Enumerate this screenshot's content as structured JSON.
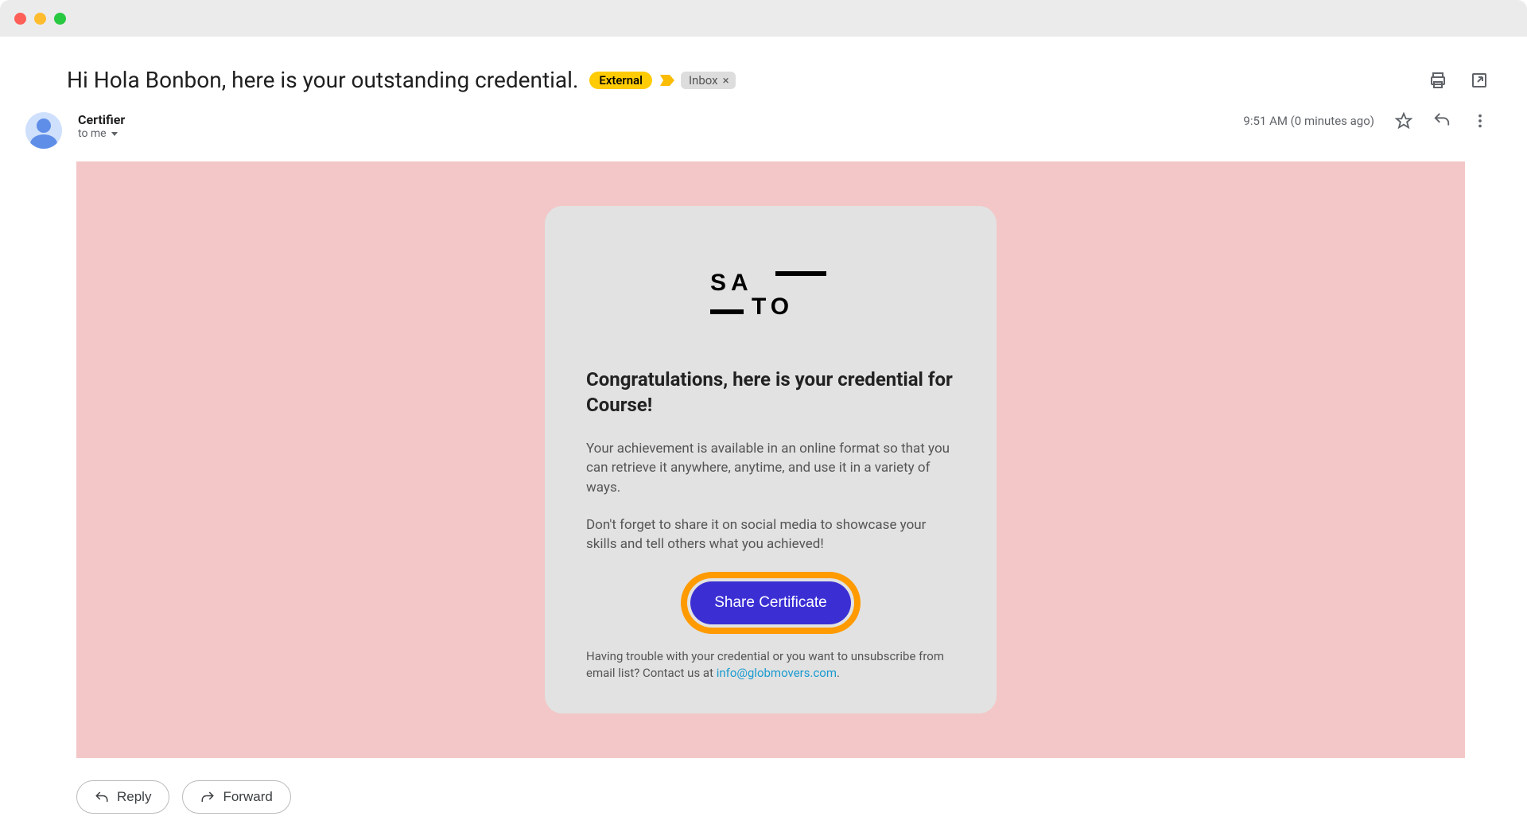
{
  "subject": "Hi Hola Bonbon, here is your outstanding credential.",
  "badges": {
    "external": "External",
    "inbox": "Inbox"
  },
  "sender": {
    "name": "Certifier",
    "to": "to me"
  },
  "meta": {
    "time": "9:51 AM (0 minutes ago)"
  },
  "emailCard": {
    "logo_text": "SATO",
    "heading": "Congratulations, here is your credential for Course!",
    "p1": "Your achievement is available in an online format so that you can retrieve it anywhere, anytime, and use it in a variety of ways.",
    "p2": "Don't forget to share it on social media to showcase your skills and tell others what you achieved!",
    "cta": "Share Certificate",
    "footer_pre": "Having trouble with your credential or you want to unsubscribe from email list? Contact us at ",
    "footer_link": "info@globmovers.com",
    "footer_post": "."
  },
  "actions": {
    "reply": "Reply",
    "forward": "Forward"
  }
}
